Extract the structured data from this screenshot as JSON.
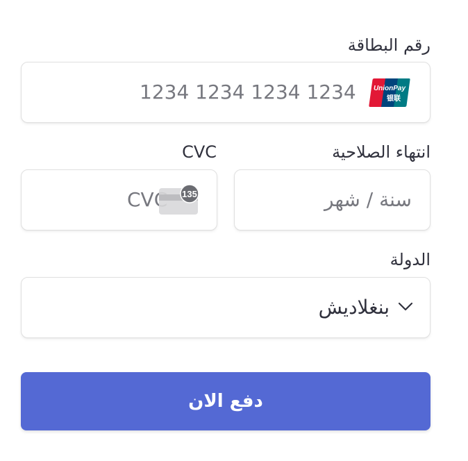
{
  "form": {
    "card_number": {
      "label": "رقم البطاقة",
      "placeholder": "1234 1234 1234 1234",
      "brand_top": "UnionPay",
      "brand_bottom": "银联"
    },
    "expiry": {
      "label": "انتهاء الصلاحية",
      "placeholder": "سنة / شهر"
    },
    "cvc": {
      "label": "CVC",
      "placeholder": "CVC",
      "hint_badge": "135"
    },
    "country": {
      "label": "الدولة",
      "value": "بنغلاديش"
    },
    "submit_label": "دفع الان"
  },
  "colors": {
    "button": "#5469d4",
    "border": "#e0e0e0",
    "text": "#30313d",
    "placeholder": "#77787f"
  },
  "icons": {
    "card_brand": "unionpay-logo",
    "cvc_hint": "cvc-card-icon",
    "dropdown": "chevron-down-icon"
  }
}
